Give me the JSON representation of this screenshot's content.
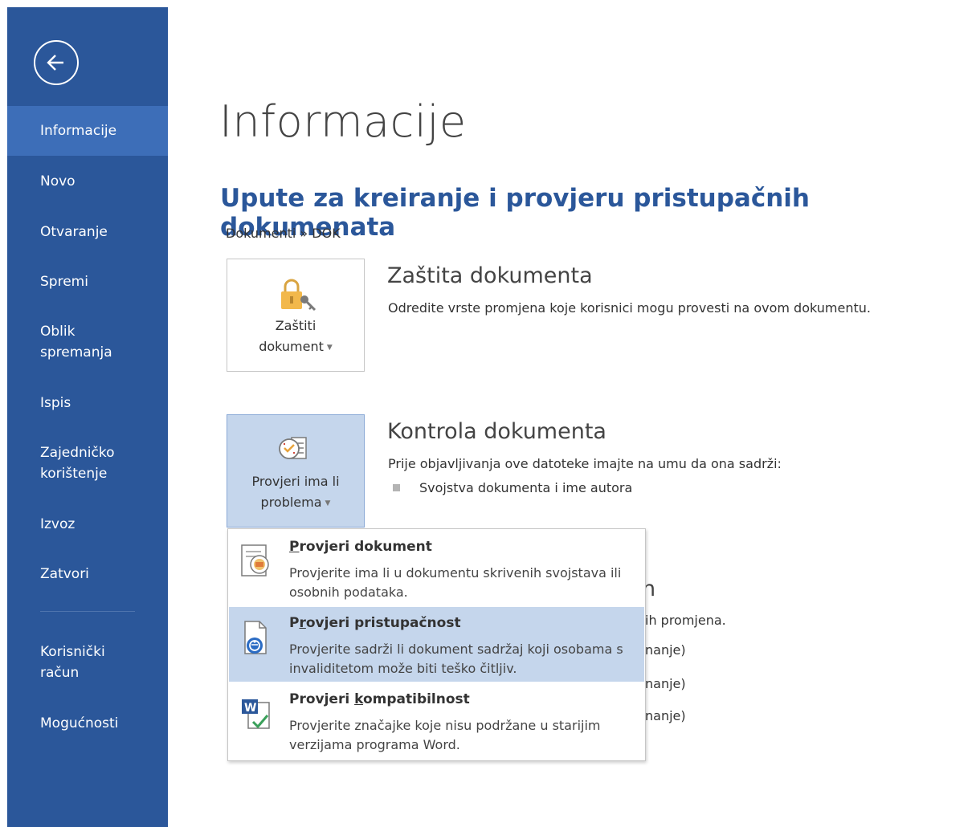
{
  "sidebar": {
    "back_label": "",
    "items": [
      {
        "label": "Informacije"
      },
      {
        "label": "Novo"
      },
      {
        "label": "Otvaranje"
      },
      {
        "label": "Spremi"
      },
      {
        "label": "Oblik\nspremanja"
      },
      {
        "label": "Ispis"
      },
      {
        "label": "Zajedničko\nkorištenje"
      },
      {
        "label": "Izvoz"
      },
      {
        "label": "Zatvori"
      },
      {
        "label": "Korisnički\nračun"
      },
      {
        "label": "Mogućnosti"
      }
    ],
    "active_item": "Informacije"
  },
  "main": {
    "title": "Informacije",
    "document_title": "Upute za kreiranje i provjeru pristupačnih dokumenata",
    "path": "Dokumenti » DOK",
    "protect": {
      "button_label_line1": "Zaštiti",
      "button_label_line2": "dokument",
      "title": "Zaštita dokumenta",
      "description": "Odredite vrste promjena koje korisnici mogu provesti na ovom dokumentu."
    },
    "inspect": {
      "button_label_line1": "Provjeri ima li",
      "button_label_line2": "problema",
      "title": "Kontrola dokumenta",
      "description": "Prije objavljivanja ove datoteke imajte na umu da ona sadrži:",
      "bullets": [
        "Svojstva dokumenta i ime autora"
      ]
    },
    "partially_hidden": {
      "heading_fragment": "n",
      "line1": "ih promjena.",
      "line2": "nanje)",
      "line3": "nanje)",
      "line4": "nanje)"
    }
  },
  "dropdown": {
    "items": [
      {
        "title_prefix": "",
        "title_underlined": "P",
        "title_rest": "rovjeri dokument",
        "description": "Provjerite ima li u dokumentu skrivenih svojstava ili osobnih podataka."
      },
      {
        "title_prefix": "P",
        "title_underlined": "r",
        "title_rest": "ovjeri pristupačnost",
        "description": "Provjerite sadrži li dokument sadržaj koji osobama s invaliditetom može biti teško čitljiv."
      },
      {
        "title_prefix": "Provjeri ",
        "title_underlined": "k",
        "title_rest": "ompatibilnost",
        "description": "Provjerite značajke koje nisu podržane u starijim verzijama programa Word."
      }
    ],
    "highlighted_item": "Provjeri pristupačnost"
  },
  "colors": {
    "sidebar_bg": "#2b579a",
    "sidebar_active": "#3d6eb8",
    "accent_title": "#2b579a",
    "highlight": "#c5d6ec"
  },
  "icons": {
    "back": "back-arrow-icon",
    "protect": "lock-key-icon",
    "inspect": "checklist-clock-icon",
    "inspect_document": "inspect-document-icon",
    "accessibility": "accessibility-check-icon",
    "compatibility": "word-compatibility-icon"
  }
}
